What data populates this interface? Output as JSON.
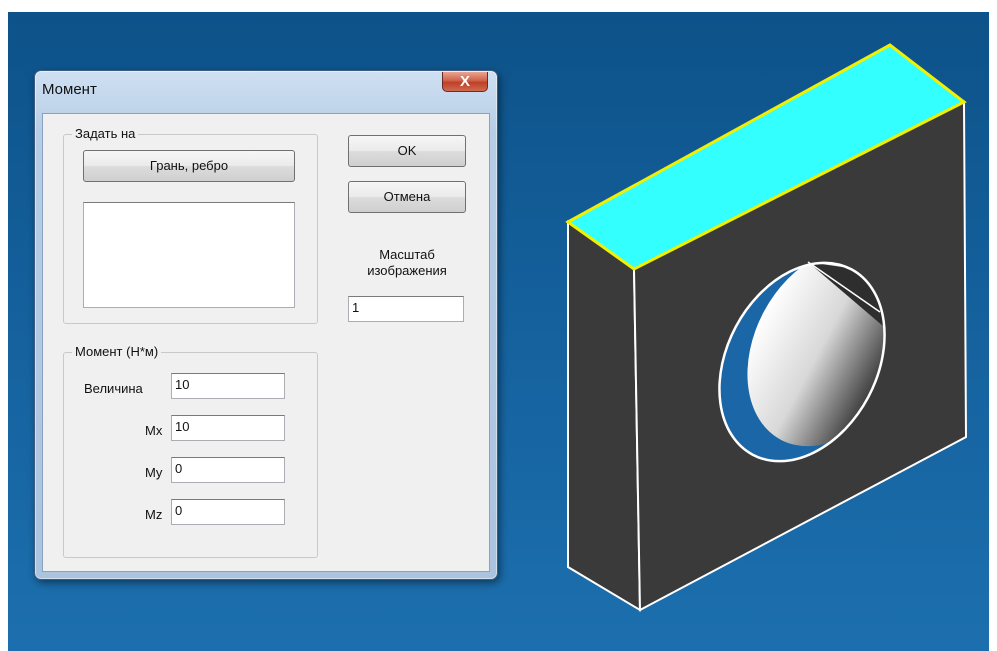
{
  "dialog": {
    "title": "Момент",
    "close_label": "X",
    "target_group": {
      "legend": "Задать на",
      "face_edge_button": "Грань, ребро",
      "selection_list": []
    },
    "moment_group": {
      "legend": "Момент (Н*м)",
      "magnitude_label": "Величина",
      "magnitude_value": "10",
      "mx_label": "Mx",
      "mx_value": "10",
      "my_label": "My",
      "my_value": "0",
      "mz_label": "Mz",
      "mz_value": "0"
    },
    "ok_button": "OK",
    "cancel_button": "Отмена",
    "scale_label_line1": "Масштаб",
    "scale_label_line2": "изображения",
    "scale_value": "1"
  },
  "colors": {
    "viewport_background": "#1a66a6",
    "part_face": "#3a3a3a",
    "selected_face": "#33ffff",
    "selected_edge": "#f0f000",
    "edge": "#ffffff"
  },
  "icons": {
    "close": "close-icon"
  }
}
